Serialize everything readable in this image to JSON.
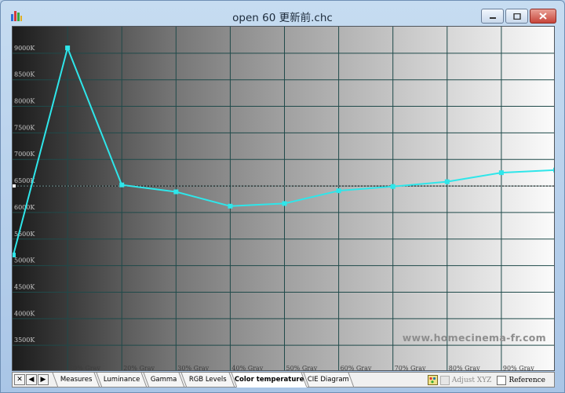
{
  "window": {
    "title": "open 60 更新前.chc",
    "app_icon": "bar-chart-icon",
    "buttons": [
      "minimize-icon",
      "maximize-icon",
      "close-icon"
    ]
  },
  "chart_data": {
    "type": "line",
    "x": [
      0,
      10,
      20,
      30,
      40,
      50,
      60,
      70,
      80,
      90,
      100
    ],
    "series": [
      {
        "values": [
          5200,
          9100,
          6520,
          6390,
          6120,
          6170,
          6410,
          6490,
          6580,
          6750,
          6800
        ]
      }
    ],
    "reference_line": 6500,
    "ylim": [
      3000,
      9500
    ],
    "yticks": [
      3500,
      4000,
      4500,
      5000,
      5500,
      6000,
      6500,
      7000,
      7500,
      8000,
      8500,
      9000
    ],
    "ytick_labels": [
      "3500K",
      "4000K",
      "4500K",
      "5000K",
      "5500K",
      "6000K",
      "6500K",
      "7000K",
      "7500K",
      "8000K",
      "8500K",
      "9000K"
    ],
    "xtick_labels": [
      "10% Gray",
      "20% Gray",
      "30% Gray",
      "40% Gray",
      "50% Gray",
      "60% Gray",
      "70% Gray",
      "80% Gray",
      "90% Gray"
    ],
    "series_color": "#2ee6ea",
    "grid": true,
    "watermark": "www.homecinema-fr.com"
  },
  "bottom_bar": {
    "nav": [
      "✕",
      "◀",
      "▶"
    ],
    "tabs": [
      "Measures",
      "Luminance",
      "Gamma",
      "RGB Levels",
      "Color temperature",
      "CIE Diagram"
    ],
    "active_tab": "Color temperature",
    "adjust_label": "Adjust XYZ",
    "reference_label": "Reference"
  }
}
